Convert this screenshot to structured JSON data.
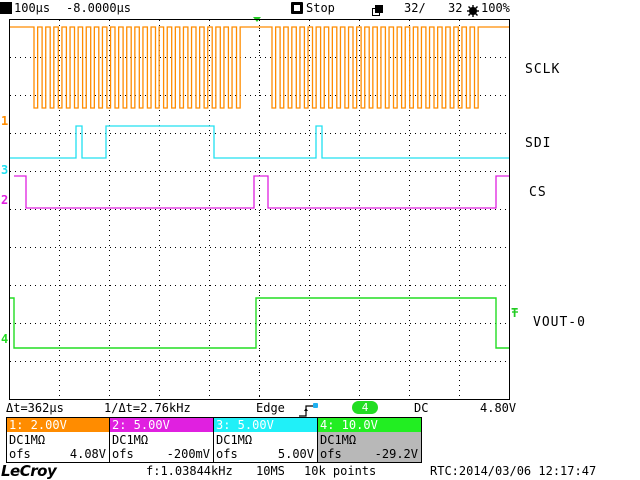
{
  "status_bar": {
    "timebase": "100µs",
    "delay": "-8.0000µs",
    "run_state": "Stop",
    "acq_count": "32/",
    "acq_total": "32",
    "battery": "100%"
  },
  "channel_labels": {
    "sclk": "SCLK",
    "sdi": "SDI",
    "cs": "CS",
    "vout": "VOUT-0"
  },
  "ground_markers": {
    "ch1": "1",
    "ch3": "3",
    "ch2": "2",
    "ch4": "4"
  },
  "trigger_level_marker": "T",
  "measurements": {
    "delta_t": "Δt=362µs",
    "inv_delta_t": "1/Δt=2.76kHz",
    "trigger_type": "Edge",
    "trigger_source": "4",
    "coupling": "DC",
    "trigger_level": "4.80V"
  },
  "channels": [
    {
      "header": "1: 2.00V",
      "coupling": "DC1MΩ",
      "ofs_label": "ofs",
      "ofs_value": "4.08V",
      "color": "#ff8c00"
    },
    {
      "header": "2: 5.00V",
      "coupling": "DC1MΩ",
      "ofs_label": "ofs",
      "ofs_value": "-200mV",
      "color": "#e020e0"
    },
    {
      "header": "3: 5.00V",
      "coupling": "DC1MΩ",
      "ofs_label": "ofs",
      "ofs_value": "5.00V",
      "color": "#20e8f0"
    },
    {
      "header": "4: 10.0V",
      "coupling": "DC1MΩ",
      "ofs_label": "ofs",
      "ofs_value": "-29.2V",
      "color": "#22dd22"
    }
  ],
  "footer": {
    "brand": "LeCroy",
    "frequency": "f:1.03844kHz",
    "sample_rate": "10MS",
    "points": "10k points",
    "rtc": "RTC:2014/03/06 12:17:47"
  },
  "colors": {
    "sclk": "#ff8c00",
    "sdi": "#20e0f0",
    "cs": "#e020e0",
    "vout": "#22dd22",
    "trigger_marker": "#22cc22",
    "grid": "#000000"
  }
}
